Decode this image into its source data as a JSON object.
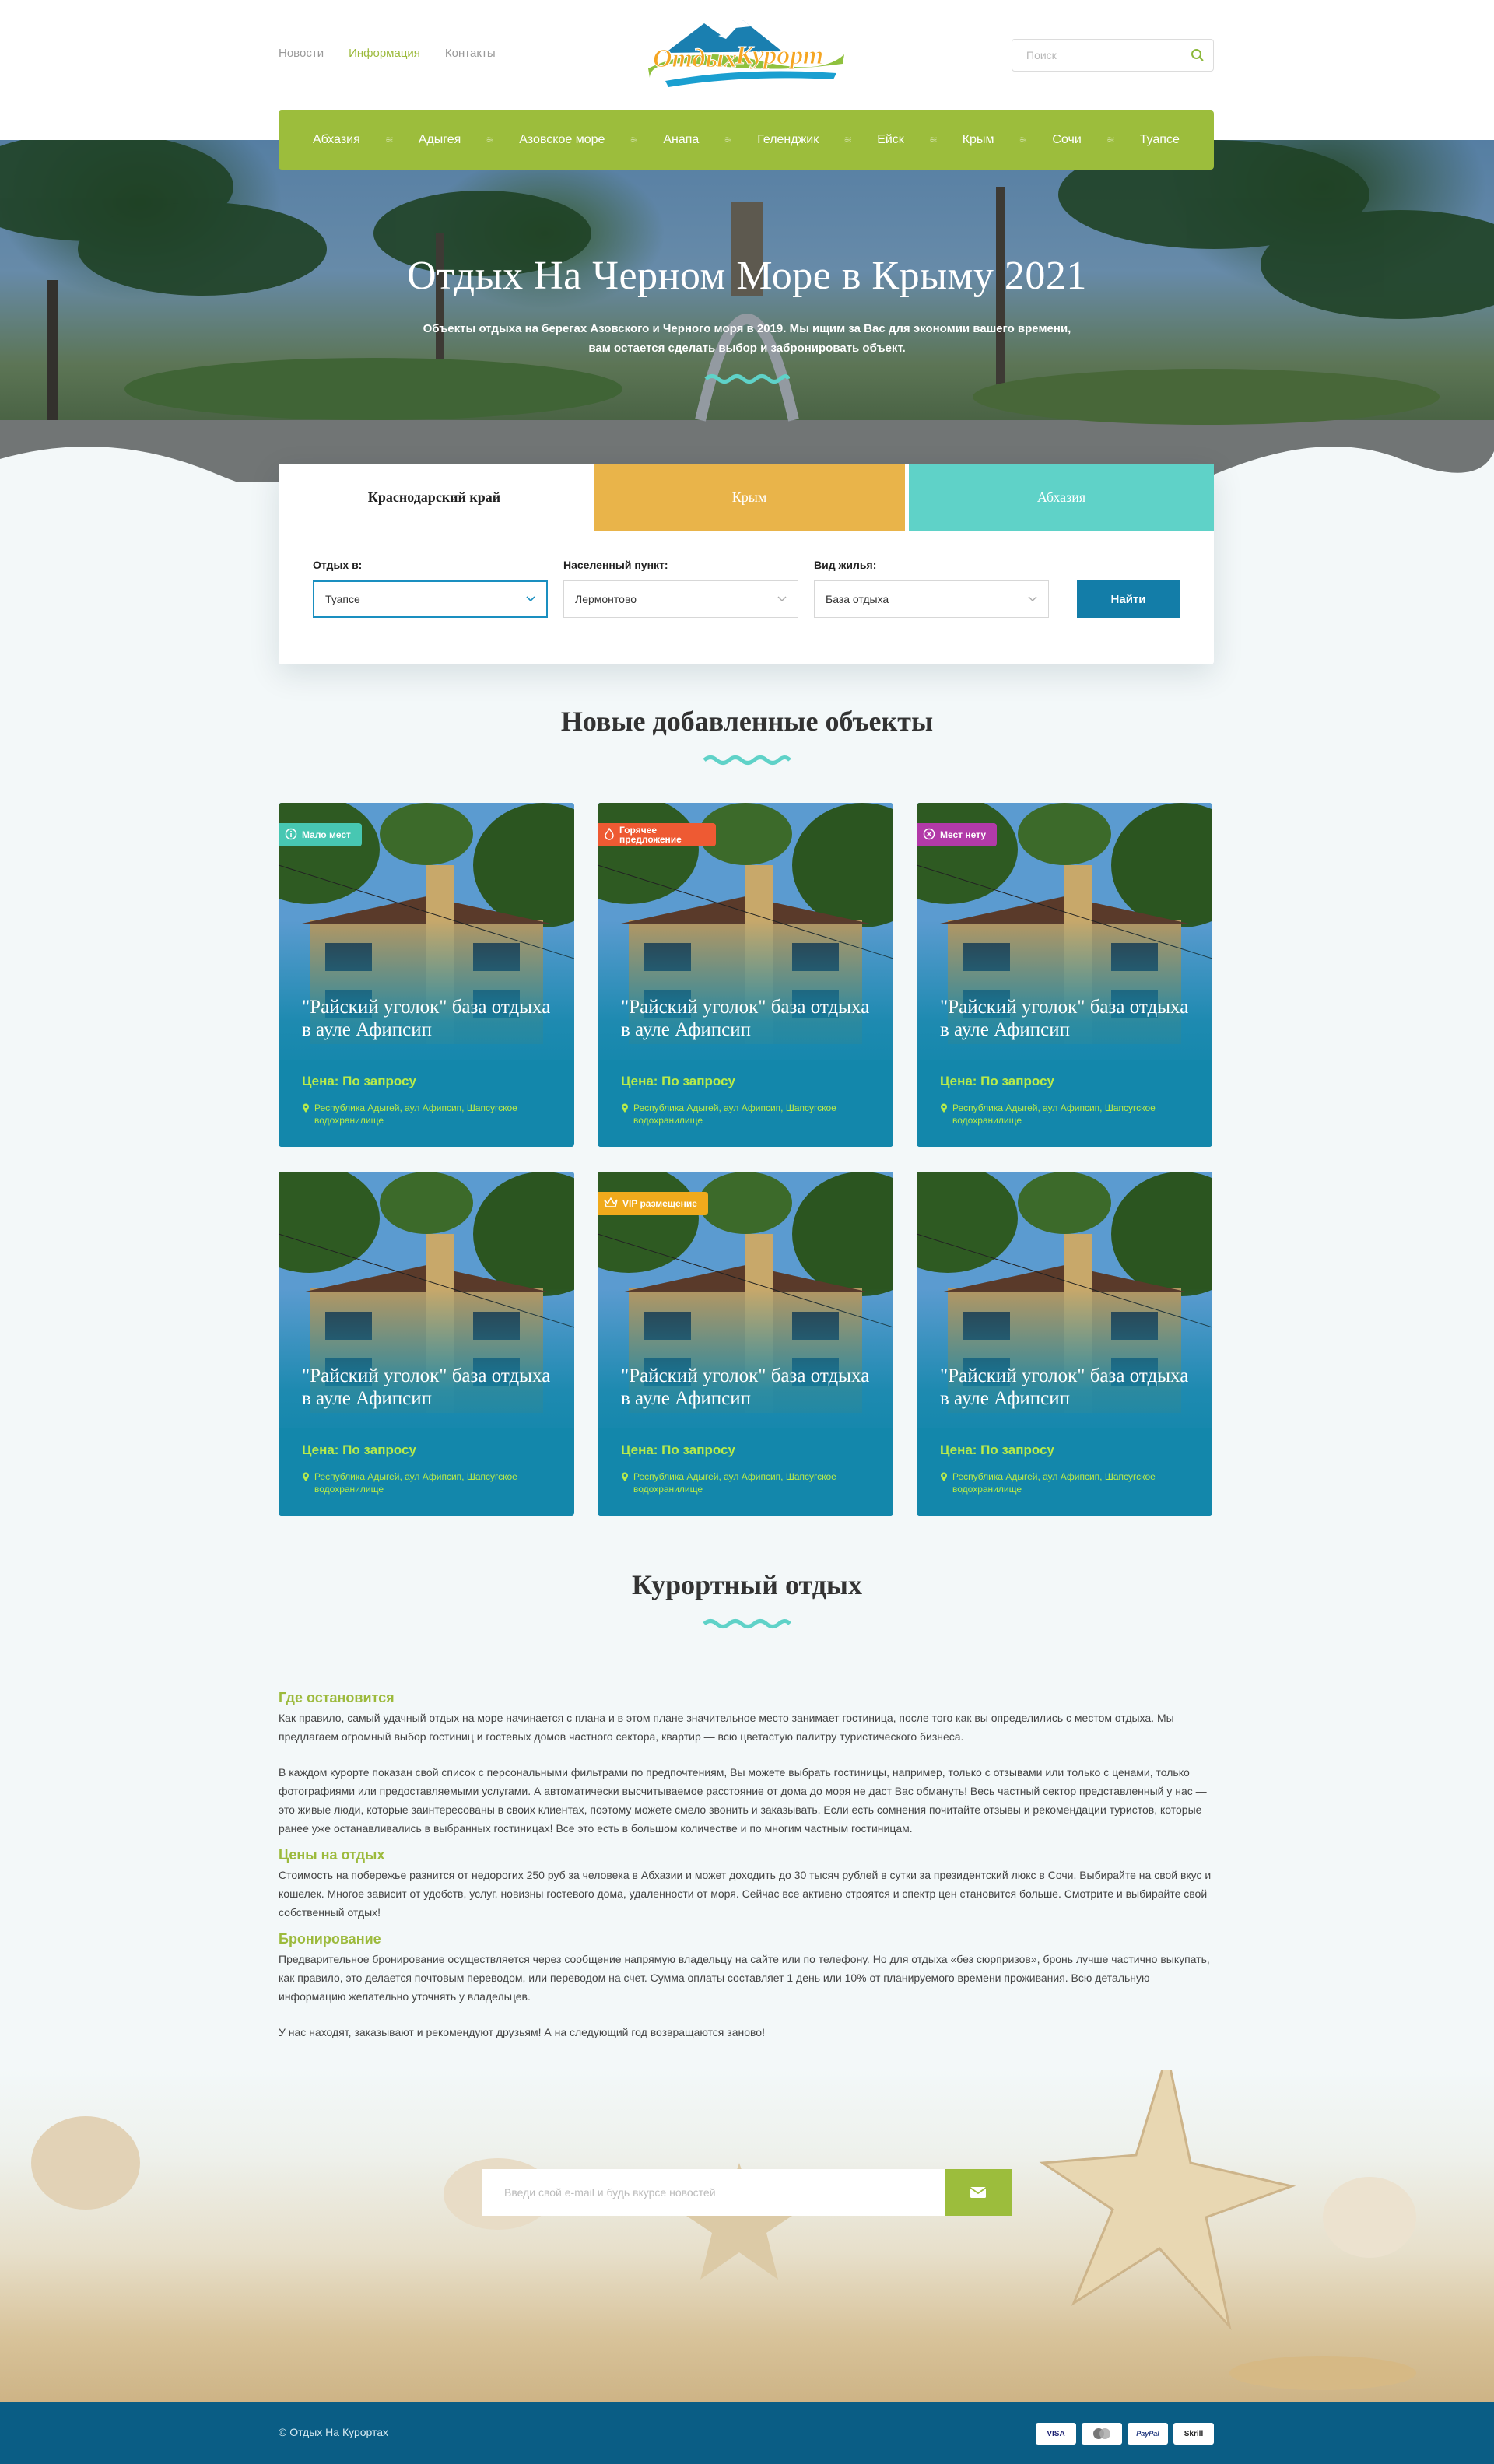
{
  "header": {
    "nav": [
      {
        "label": "Новости",
        "active": false
      },
      {
        "label": "Информация",
        "active": true
      },
      {
        "label": "Контакты",
        "active": false
      }
    ],
    "logo": {
      "word1": "Отдых",
      "word2": "Курорт"
    },
    "search": {
      "placeholder": "Поиск",
      "icon": "search-icon"
    }
  },
  "regions": [
    "Абхазия",
    "Адыгея",
    "Азовское море",
    "Анапа",
    "Геленджик",
    "Ейск",
    "Крым",
    "Сочи",
    "Туапсе"
  ],
  "hero": {
    "title": "Отдых На Черном Море в Крыму 2021",
    "subtitle": "Объекты отдыха на берегах Азовского и Черного моря в 2019. Мы ищим за Вас для экономии вашего времени, вам остается сделать выбор и забронировать объект."
  },
  "search_panel": {
    "tabs": [
      "Краснодарский край",
      "Крым",
      "Абхазия"
    ],
    "fields": [
      {
        "label": "Отдых в:",
        "value": "Туапсе"
      },
      {
        "label": "Населенный пункт:",
        "value": "Лермонтово"
      },
      {
        "label": "Вид жилья:",
        "value": "База отдыха"
      }
    ],
    "button": "Найти"
  },
  "new_objects": {
    "title": "Новые добавленные объекты",
    "cards": [
      {
        "badge": "Мало мест",
        "badge_icon": "info-icon",
        "badge_color": "#47c7b2",
        "title": "\"Райский уголок\" база отдыха в ауле Афипсип",
        "price": "Цена: По запросу",
        "address": "Республика Адыгей, аул Афипсип, Шапсугское водохранилище"
      },
      {
        "badge": "Горячее предложение",
        "badge_icon": "flame-icon",
        "badge_color": "#ee5a33",
        "title": "\"Райский уголок\" база отдыха в ауле Афипсип",
        "price": "Цена: По запросу",
        "address": "Республика Адыгей, аул Афипсип, Шапсугское водохранилище"
      },
      {
        "badge": "Мест нету",
        "badge_icon": "close-circle-icon",
        "badge_color": "#b23aa8",
        "title": "\"Райский уголок\" база отдыха в ауле Афипсип",
        "price": "Цена: По запросу",
        "address": "Республика Адыгей, аул Афипсип, Шапсугское водохранилище"
      },
      {
        "badge": "",
        "badge_icon": "",
        "badge_color": "",
        "title": "\"Райский уголок\" база отдыха в ауле Афипсип",
        "price": "Цена: По запросу",
        "address": "Республика Адыгей, аул Афипсип, Шапсугское водохранилище"
      },
      {
        "badge": "VIP размещение",
        "badge_icon": "crown-icon",
        "badge_color": "#f0aa1c",
        "title": "\"Райский уголок\" база отдыха в ауле Афипсип",
        "price": "Цена: По запросу",
        "address": "Республика Адыгей, аул Афипсип, Шапсугское водохранилище"
      },
      {
        "badge": "",
        "badge_icon": "",
        "badge_color": "",
        "title": "\"Райский уголок\" база отдыха в ауле Афипсип",
        "price": "Цена: По запросу",
        "address": "Республика Адыгей, аул Афипсип, Шапсугское водохранилище"
      }
    ]
  },
  "resort": {
    "title": "Курортный отдых",
    "sections": [
      {
        "heading": "Где остановится",
        "paragraphs": [
          "Как правило, самый удачный отдых на море начинается с плана и в этом плане значительное место занимает гостиница, после того как вы определились с местом отдыха. Мы предлагаем огромный выбор гостиниц и гостевых домов частного сектора, квартир — всю цветастую палитру туристического бизнеса.",
          "В каждом курорте показан свой список с персональными фильтрами по предпочтениям, Вы можете выбрать гостиницы, например, только с отзывами или только с ценами, только фотографиями или предоставляемыми услугами. А автоматически высчитываемое расстояние от дома до моря не даст Вас обмануть! Весь частный сектор представленный у нас — это живые люди, которые заинтересованы в своих клиентах, поэтому можете смело звонить и заказывать. Если есть сомнения почитайте отзывы и рекомендации туристов, которые ранее уже останавливались в выбранных гостиницах! Все это есть в большом количестве и по многим частным гостиницам."
        ]
      },
      {
        "heading": "Цены на отдых",
        "paragraphs": [
          "Стоимость на побережье разнится от недорогих 250 руб за человека в Абхазии и может доходить до 30 тысяч рублей в сутки за президентский люкс в Сочи. Выбирайте на свой вкус и кошелек. Многое зависит от удобств, услуг, новизны гостевого дома, удаленности от моря. Сейчас все активно строятся и спектр цен становится больше. Смотрите и выбирайте свой собственный отдых!"
        ]
      },
      {
        "heading": "Бронирование",
        "paragraphs": [
          "Предварительное бронирование осуществляется через сообщение напрямую владельцу на сайте или по телефону. Но для отдыха «без сюрпризов», бронь лучше частично выкупать, как правило, это делается почтовым переводом, или переводом на счет. Сумма оплаты составляет 1 день или 10% от планируемого времени проживания. Всю детальную информацию желательно уточнять у владельцев.",
          "У нас находят, заказывают и рекомендуют друзьям! А на следующий год возвращаются заново!"
        ]
      }
    ]
  },
  "subscribe": {
    "placeholder": "Введи свой e-mail и будь вкурсе новостей",
    "icon": "envelope-icon"
  },
  "footer": {
    "copyright": "©  Отдых На Курортах",
    "payments": [
      "VISA",
      "MasterCard",
      "PayPal",
      "Skrill"
    ]
  },
  "colors": {
    "accent_green": "#9cbd3c",
    "accent_blue": "#137da8",
    "tab_orange": "#e9b44a",
    "tab_teal": "#5fd2c8",
    "footer": "#0a5d85"
  }
}
